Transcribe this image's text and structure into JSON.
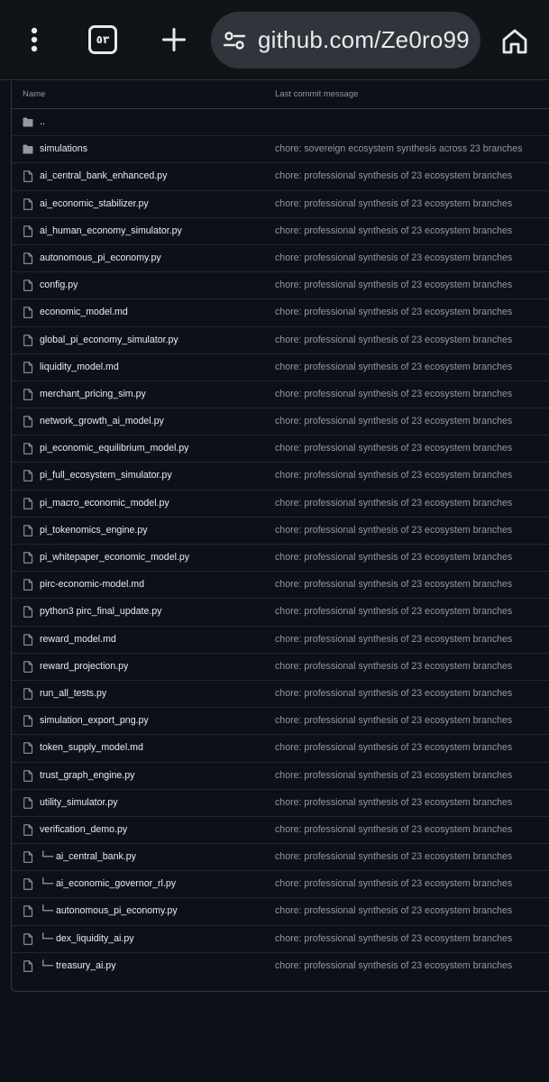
{
  "browser": {
    "tab_count": "٥٣",
    "url": "github.com/Ze0ro99",
    "icons": {
      "menu": "three-dots-vertical-icon",
      "tabs": "tab-switcher-icon",
      "new_tab": "plus-icon",
      "site_settings": "tune-icon",
      "home": "home-icon"
    }
  },
  "table": {
    "header": {
      "name": "Name",
      "message": "Last commit message"
    },
    "rows": [
      {
        "type": "dir",
        "name": "..",
        "message": ""
      },
      {
        "type": "dir",
        "name": "simulations",
        "message": "chore: sovereign ecosystem synthesis across 23 branches"
      },
      {
        "type": "file",
        "name": "ai_central_bank_enhanced.py",
        "message": "chore: professional synthesis of 23 ecosystem branches"
      },
      {
        "type": "file",
        "name": "ai_economic_stabilizer.py",
        "message": "chore: professional synthesis of 23 ecosystem branches"
      },
      {
        "type": "file",
        "name": "ai_human_economy_simulator.py",
        "message": "chore: professional synthesis of 23 ecosystem branches"
      },
      {
        "type": "file",
        "name": "autonomous_pi_economy.py",
        "message": "chore: professional synthesis of 23 ecosystem branches"
      },
      {
        "type": "file",
        "name": "config.py",
        "message": "chore: professional synthesis of 23 ecosystem branches"
      },
      {
        "type": "file",
        "name": "economic_model.md",
        "message": "chore: professional synthesis of 23 ecosystem branches"
      },
      {
        "type": "file",
        "name": "global_pi_economy_simulator.py",
        "message": "chore: professional synthesis of 23 ecosystem branches"
      },
      {
        "type": "file",
        "name": "liquidity_model.md",
        "message": "chore: professional synthesis of 23 ecosystem branches"
      },
      {
        "type": "file",
        "name": "merchant_pricing_sim.py",
        "message": "chore: professional synthesis of 23 ecosystem branches"
      },
      {
        "type": "file",
        "name": "network_growth_ai_model.py",
        "message": "chore: professional synthesis of 23 ecosystem branches"
      },
      {
        "type": "file",
        "name": "pi_economic_equilibrium_model.py",
        "message": "chore: professional synthesis of 23 ecosystem branches"
      },
      {
        "type": "file",
        "name": "pi_full_ecosystem_simulator.py",
        "message": "chore: professional synthesis of 23 ecosystem branches"
      },
      {
        "type": "file",
        "name": "pi_macro_economic_model.py",
        "message": "chore: professional synthesis of 23 ecosystem branches"
      },
      {
        "type": "file",
        "name": "pi_tokenomics_engine.py",
        "message": "chore: professional synthesis of 23 ecosystem branches"
      },
      {
        "type": "file",
        "name": "pi_whitepaper_economic_model.py",
        "message": "chore: professional synthesis of 23 ecosystem branches"
      },
      {
        "type": "file",
        "name": "pirc-economic-model.md",
        "message": "chore: professional synthesis of 23 ecosystem branches"
      },
      {
        "type": "file",
        "name": "python3 pirc_final_update.py",
        "message": "chore: professional synthesis of 23 ecosystem branches"
      },
      {
        "type": "file",
        "name": "reward_model.md",
        "message": "chore: professional synthesis of 23 ecosystem branches"
      },
      {
        "type": "file",
        "name": "reward_projection.py",
        "message": "chore: professional synthesis of 23 ecosystem branches"
      },
      {
        "type": "file",
        "name": "run_all_tests.py",
        "message": "chore: professional synthesis of 23 ecosystem branches"
      },
      {
        "type": "file",
        "name": "simulation_export_png.py",
        "message": "chore: professional synthesis of 23 ecosystem branches"
      },
      {
        "type": "file",
        "name": "token_supply_model.md",
        "message": "chore: professional synthesis of 23 ecosystem branches"
      },
      {
        "type": "file",
        "name": "trust_graph_engine.py",
        "message": "chore: professional synthesis of 23 ecosystem branches"
      },
      {
        "type": "file",
        "name": "utility_simulator.py",
        "message": "chore: professional synthesis of 23 ecosystem branches"
      },
      {
        "type": "file",
        "name": "verification_demo.py",
        "message": "chore: professional synthesis of 23 ecosystem branches"
      },
      {
        "type": "file",
        "name": "└─ ai_central_bank.py",
        "message": "chore: professional synthesis of 23 ecosystem branches"
      },
      {
        "type": "file",
        "name": "└─ ai_economic_governor_rl.py",
        "message": "chore: professional synthesis of 23 ecosystem branches"
      },
      {
        "type": "file",
        "name": "└─ autonomous_pi_economy.py",
        "message": "chore: professional synthesis of 23 ecosystem branches"
      },
      {
        "type": "file",
        "name": "└─ dex_liquidity_ai.py",
        "message": "chore: professional synthesis of 23 ecosystem branches"
      },
      {
        "type": "file",
        "name": "└─ treasury_ai.py",
        "message": "chore: professional synthesis of 23 ecosystem branches"
      }
    ]
  },
  "colors": {
    "page_bg": "#0d1117",
    "border": "#30363d",
    "text_primary": "#e6edf3",
    "text_muted": "#9198a1",
    "icon": "#9198a1"
  }
}
